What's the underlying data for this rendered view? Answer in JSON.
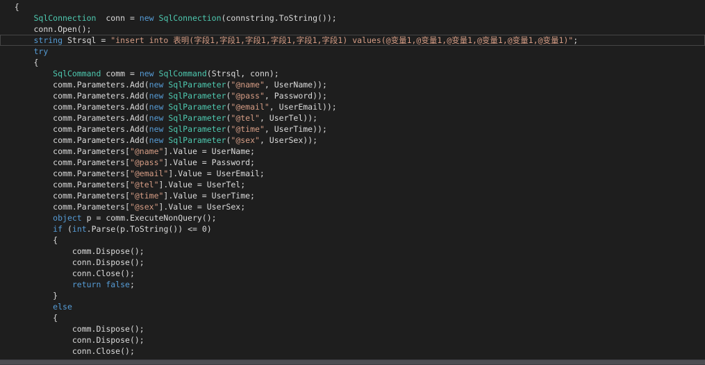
{
  "editor": {
    "lines": [
      {
        "indent": 3,
        "tokens": [
          {
            "t": "{",
            "c": "plain"
          }
        ]
      },
      {
        "indent": 7,
        "tokens": [
          {
            "t": "SqlConnection",
            "c": "type"
          },
          {
            "t": "  conn = ",
            "c": "plain"
          },
          {
            "t": "new",
            "c": "kw"
          },
          {
            "t": " ",
            "c": "plain"
          },
          {
            "t": "SqlConnection",
            "c": "type"
          },
          {
            "t": "(connstring.ToString());",
            "c": "plain"
          }
        ]
      },
      {
        "indent": 7,
        "tokens": [
          {
            "t": "conn.Open();",
            "c": "plain"
          }
        ]
      },
      {
        "indent": 7,
        "current": true,
        "tokens": [
          {
            "t": "string",
            "c": "kw"
          },
          {
            "t": " Strsql = ",
            "c": "plain"
          },
          {
            "t": "\"insert into 表明(字段1,字段1,字段1,字段1,字段1,字段1) values(@变量1,@变量1,@变量1,@变量1,@变量1,@变量1)\"",
            "c": "str"
          },
          {
            "t": ";",
            "c": "plain"
          }
        ]
      },
      {
        "indent": 7,
        "tokens": [
          {
            "t": "try",
            "c": "kw"
          }
        ]
      },
      {
        "indent": 7,
        "tokens": [
          {
            "t": "{",
            "c": "plain"
          }
        ]
      },
      {
        "indent": 11,
        "tokens": [
          {
            "t": "SqlCommand",
            "c": "type"
          },
          {
            "t": " comm = ",
            "c": "plain"
          },
          {
            "t": "new",
            "c": "kw"
          },
          {
            "t": " ",
            "c": "plain"
          },
          {
            "t": "SqlCommand",
            "c": "type"
          },
          {
            "t": "(Strsql, conn);",
            "c": "plain"
          }
        ]
      },
      {
        "indent": 11,
        "tokens": [
          {
            "t": "comm.Parameters.Add(",
            "c": "plain"
          },
          {
            "t": "new",
            "c": "kw"
          },
          {
            "t": " ",
            "c": "plain"
          },
          {
            "t": "SqlParameter",
            "c": "type"
          },
          {
            "t": "(",
            "c": "plain"
          },
          {
            "t": "\"@name\"",
            "c": "str"
          },
          {
            "t": ", UserName));",
            "c": "plain"
          }
        ]
      },
      {
        "indent": 11,
        "tokens": [
          {
            "t": "comm.Parameters.Add(",
            "c": "plain"
          },
          {
            "t": "new",
            "c": "kw"
          },
          {
            "t": " ",
            "c": "plain"
          },
          {
            "t": "SqlParameter",
            "c": "type"
          },
          {
            "t": "(",
            "c": "plain"
          },
          {
            "t": "\"@pass\"",
            "c": "str"
          },
          {
            "t": ", Password));",
            "c": "plain"
          }
        ]
      },
      {
        "indent": 11,
        "tokens": [
          {
            "t": "comm.Parameters.Add(",
            "c": "plain"
          },
          {
            "t": "new",
            "c": "kw"
          },
          {
            "t": " ",
            "c": "plain"
          },
          {
            "t": "SqlParameter",
            "c": "type"
          },
          {
            "t": "(",
            "c": "plain"
          },
          {
            "t": "\"@email\"",
            "c": "str"
          },
          {
            "t": ", UserEmail));",
            "c": "plain"
          }
        ]
      },
      {
        "indent": 11,
        "tokens": [
          {
            "t": "comm.Parameters.Add(",
            "c": "plain"
          },
          {
            "t": "new",
            "c": "kw"
          },
          {
            "t": " ",
            "c": "plain"
          },
          {
            "t": "SqlParameter",
            "c": "type"
          },
          {
            "t": "(",
            "c": "plain"
          },
          {
            "t": "\"@tel\"",
            "c": "str"
          },
          {
            "t": ", UserTel));",
            "c": "plain"
          }
        ]
      },
      {
        "indent": 11,
        "tokens": [
          {
            "t": "comm.Parameters.Add(",
            "c": "plain"
          },
          {
            "t": "new",
            "c": "kw"
          },
          {
            "t": " ",
            "c": "plain"
          },
          {
            "t": "SqlParameter",
            "c": "type"
          },
          {
            "t": "(",
            "c": "plain"
          },
          {
            "t": "\"@time\"",
            "c": "str"
          },
          {
            "t": ", UserTime));",
            "c": "plain"
          }
        ]
      },
      {
        "indent": 11,
        "tokens": [
          {
            "t": "comm.Parameters.Add(",
            "c": "plain"
          },
          {
            "t": "new",
            "c": "kw"
          },
          {
            "t": " ",
            "c": "plain"
          },
          {
            "t": "SqlParameter",
            "c": "type"
          },
          {
            "t": "(",
            "c": "plain"
          },
          {
            "t": "\"@sex\"",
            "c": "str"
          },
          {
            "t": ", UserSex));",
            "c": "plain"
          }
        ]
      },
      {
        "indent": 11,
        "tokens": [
          {
            "t": "comm.Parameters[",
            "c": "plain"
          },
          {
            "t": "\"@name\"",
            "c": "str"
          },
          {
            "t": "].Value = UserName;",
            "c": "plain"
          }
        ]
      },
      {
        "indent": 11,
        "tokens": [
          {
            "t": "comm.Parameters[",
            "c": "plain"
          },
          {
            "t": "\"@pass\"",
            "c": "str"
          },
          {
            "t": "].Value = Password;",
            "c": "plain"
          }
        ]
      },
      {
        "indent": 11,
        "tokens": [
          {
            "t": "comm.Parameters[",
            "c": "plain"
          },
          {
            "t": "\"@email\"",
            "c": "str"
          },
          {
            "t": "].Value = UserEmail;",
            "c": "plain"
          }
        ]
      },
      {
        "indent": 11,
        "tokens": [
          {
            "t": "comm.Parameters[",
            "c": "plain"
          },
          {
            "t": "\"@tel\"",
            "c": "str"
          },
          {
            "t": "].Value = UserTel;",
            "c": "plain"
          }
        ]
      },
      {
        "indent": 11,
        "tokens": [
          {
            "t": "comm.Parameters[",
            "c": "plain"
          },
          {
            "t": "\"@time\"",
            "c": "str"
          },
          {
            "t": "].Value = UserTime;",
            "c": "plain"
          }
        ]
      },
      {
        "indent": 11,
        "tokens": [
          {
            "t": "comm.Parameters[",
            "c": "plain"
          },
          {
            "t": "\"@sex\"",
            "c": "str"
          },
          {
            "t": "].Value = UserSex;",
            "c": "plain"
          }
        ]
      },
      {
        "indent": 11,
        "tokens": [
          {
            "t": "object",
            "c": "kw"
          },
          {
            "t": " p = comm.ExecuteNonQuery();",
            "c": "plain"
          }
        ]
      },
      {
        "indent": 11,
        "tokens": [
          {
            "t": "if",
            "c": "kw"
          },
          {
            "t": " (",
            "c": "plain"
          },
          {
            "t": "int",
            "c": "kw"
          },
          {
            "t": ".Parse(p.ToString()) <= 0)",
            "c": "plain"
          }
        ]
      },
      {
        "indent": 11,
        "tokens": [
          {
            "t": "{",
            "c": "plain"
          }
        ]
      },
      {
        "indent": 15,
        "tokens": [
          {
            "t": "comm.Dispose();",
            "c": "plain"
          }
        ]
      },
      {
        "indent": 15,
        "tokens": [
          {
            "t": "conn.Dispose();",
            "c": "plain"
          }
        ]
      },
      {
        "indent": 15,
        "tokens": [
          {
            "t": "conn.Close();",
            "c": "plain"
          }
        ]
      },
      {
        "indent": 15,
        "tokens": [
          {
            "t": "return",
            "c": "kw"
          },
          {
            "t": " ",
            "c": "plain"
          },
          {
            "t": "false",
            "c": "kw"
          },
          {
            "t": ";",
            "c": "plain"
          }
        ]
      },
      {
        "indent": 11,
        "tokens": [
          {
            "t": "}",
            "c": "plain"
          }
        ]
      },
      {
        "indent": 11,
        "tokens": [
          {
            "t": "else",
            "c": "kw"
          }
        ]
      },
      {
        "indent": 11,
        "tokens": [
          {
            "t": "{",
            "c": "plain"
          }
        ]
      },
      {
        "indent": 15,
        "tokens": [
          {
            "t": "comm.Dispose();",
            "c": "plain"
          }
        ]
      },
      {
        "indent": 15,
        "tokens": [
          {
            "t": "conn.Dispose();",
            "c": "plain"
          }
        ]
      },
      {
        "indent": 15,
        "tokens": [
          {
            "t": "conn.Close();",
            "c": "plain"
          }
        ]
      }
    ]
  },
  "colors": {
    "background": "#1e1e1e",
    "keyword": "#569cd6",
    "type": "#4ec9b0",
    "string": "#d69d85",
    "text": "#dcdcdc"
  }
}
